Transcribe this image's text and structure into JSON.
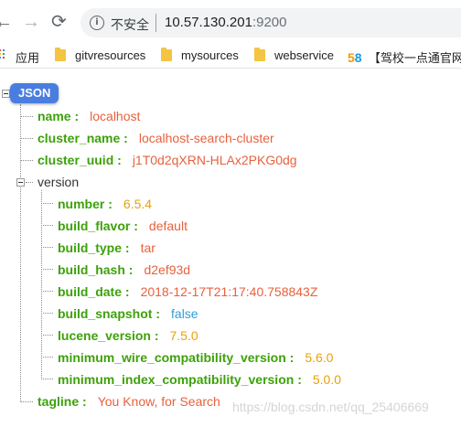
{
  "browser": {
    "security_label": "不安全",
    "url_host": "10.57.130.201",
    "url_port": ":9200"
  },
  "bookmarks": {
    "apps_label": "应用",
    "items": [
      "gitvresources",
      "mysources",
      "webservice"
    ],
    "site_58_five": "5",
    "site_58_eight": "8",
    "site_58_label": "【驾校一点通官网】"
  },
  "tree": {
    "root_label": "JSON",
    "colon": ":",
    "name_key": "name",
    "name_value": "localhost",
    "cluster_name_key": "cluster_name",
    "cluster_name_value": "localhost-search-cluster",
    "cluster_uuid_key": "cluster_uuid",
    "cluster_uuid_value": "j1T0d2qXRN-HLAx2PKG0dg",
    "version_key": "version",
    "version": {
      "number_key": "number",
      "number_value": "6.5.4",
      "build_flavor_key": "build_flavor",
      "build_flavor_value": "default",
      "build_type_key": "build_type",
      "build_type_value": "tar",
      "build_hash_key": "build_hash",
      "build_hash_value": "d2ef93d",
      "build_date_key": "build_date",
      "build_date_value": "2018-12-17T21:17:40.758843Z",
      "build_snapshot_key": "build_snapshot",
      "build_snapshot_value": "false",
      "lucene_version_key": "lucene_version",
      "lucene_version_value": "7.5.0",
      "min_wire_key": "minimum_wire_compatibility_version",
      "min_wire_value": "5.6.0",
      "min_index_key": "minimum_index_compatibility_version",
      "min_index_value": "5.0.0"
    },
    "tagline_key": "tagline",
    "tagline_value": "You Know, for Search"
  },
  "watermark": "https://blog.csdn.net/qq_25406669",
  "colors": {
    "key": "#3da10a",
    "string": "#e8613d",
    "number": "#e8a10c",
    "boolean": "#2b9fd9",
    "root_badge": "#4a7de0"
  }
}
